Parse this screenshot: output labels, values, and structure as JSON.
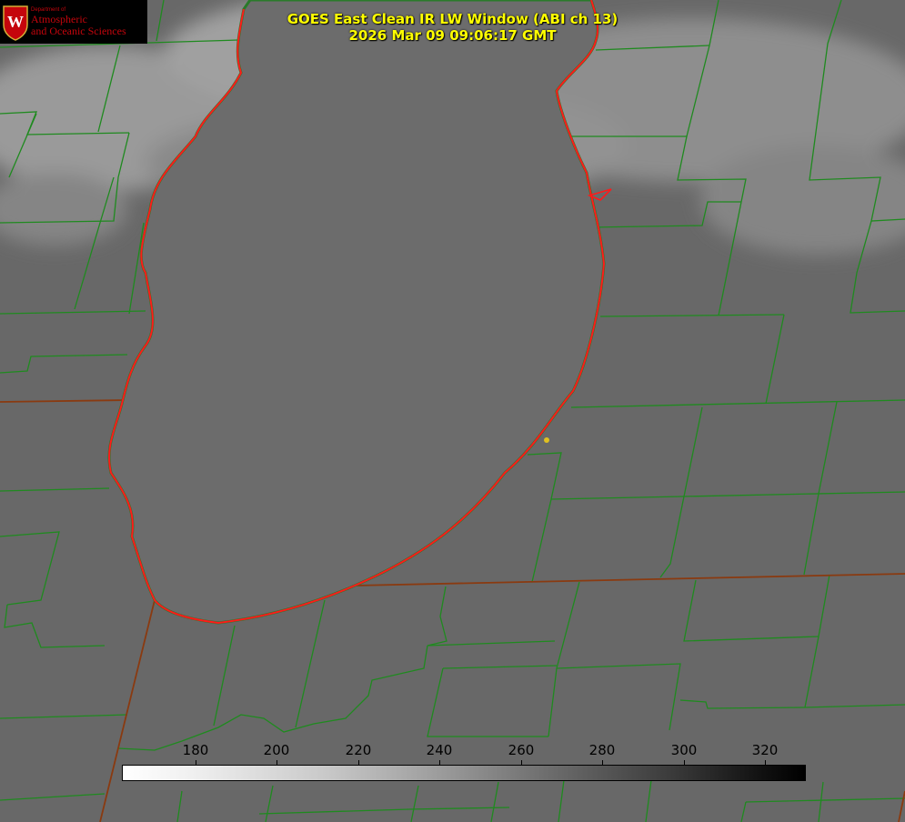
{
  "logo": {
    "dept": "Department of",
    "line1": "Atmospheric",
    "line2": "and Oceanic Sciences",
    "seal_letter": "W"
  },
  "title": {
    "line1": "GOES East Clean IR LW Window (ABI ch 13)",
    "line2": "2026 Mar 09 09:06:17 GMT"
  },
  "colorbar": {
    "ticks": [
      "180",
      "200",
      "220",
      "240",
      "260",
      "280",
      "300",
      "320"
    ]
  },
  "colors": {
    "background_gray": "#6b6b6b",
    "lake_gray": "#6a6a6a",
    "county_lines": "#1f8a1f",
    "state_lines": "#8a3a10",
    "shoreline": "#ff1a1a",
    "title_text": "#ffff00",
    "marker": "#e0c020"
  },
  "map_features": [
    "cloud-field",
    "lake-shoreline",
    "county-boundaries",
    "state-boundaries",
    "location-marker"
  ]
}
